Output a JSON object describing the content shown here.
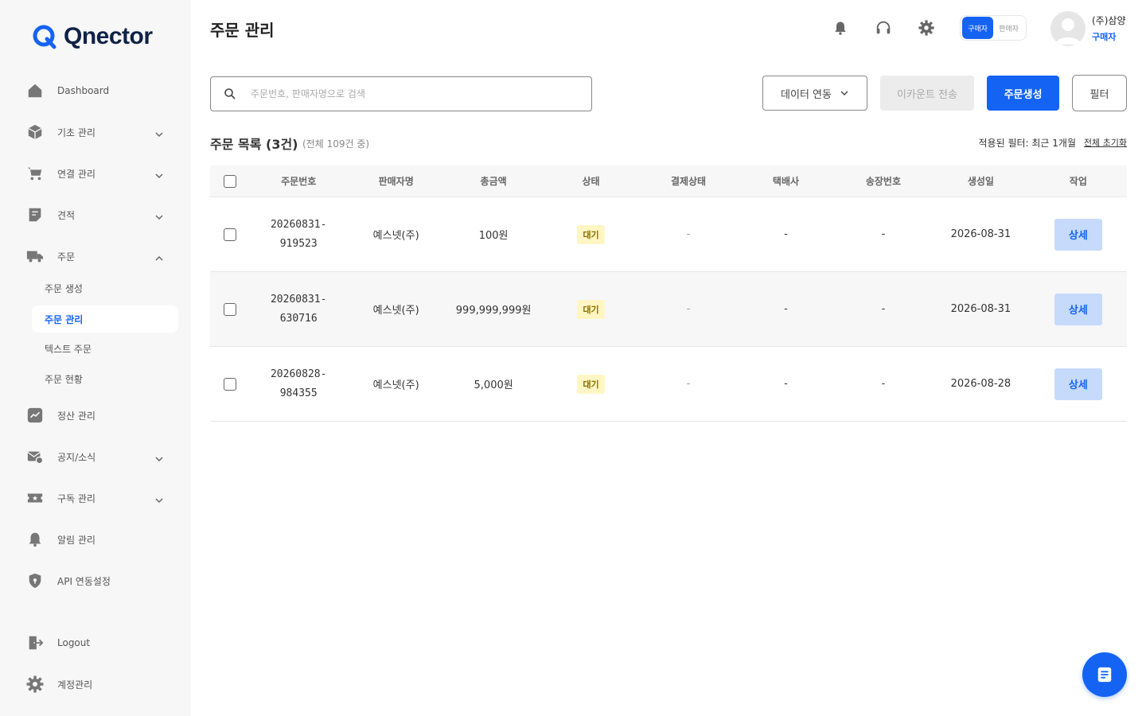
{
  "brand": {
    "name": "Qnector",
    "color": "#1463f3"
  },
  "sidebar": {
    "items": [
      {
        "label": "Dashboard",
        "icon": "home-icon"
      },
      {
        "label": "기초 관리",
        "icon": "box-icon"
      },
      {
        "label": "연결 관리",
        "icon": "cart-icon"
      },
      {
        "label": "견적",
        "icon": "receipt-icon"
      },
      {
        "label": "주문",
        "icon": "truck-icon"
      },
      {
        "label": "정산 관리",
        "icon": "trend-chart-icon"
      },
      {
        "label": "공지/소식",
        "icon": "mail-icon"
      },
      {
        "label": "구독 관리",
        "icon": "ticket-icon"
      },
      {
        "label": "알림 관리",
        "icon": "bell-icon"
      },
      {
        "label": "API 연동설정",
        "icon": "shield-icon"
      },
      {
        "label": "Logout",
        "icon": "logout-icon"
      },
      {
        "label": "계정관리",
        "icon": "gear-icon"
      }
    ],
    "order_sub": [
      {
        "label": "주문 생성"
      },
      {
        "label": "주문 관리"
      },
      {
        "label": "텍스트 주문"
      },
      {
        "label": "주문 현황"
      }
    ]
  },
  "header": {
    "title": "주문 관리",
    "role_buyer": "구매자",
    "role_seller": "판매자",
    "user_name": "(주)삼양",
    "user_role": "구매자"
  },
  "toolbar": {
    "search_placeholder": "주문번호, 판매자명으로 검색",
    "data_link": "데이터 연동",
    "ecount": "이카운트 전송",
    "create_order": "주문생성",
    "filter": "필터"
  },
  "list": {
    "title": "주문 목록 (3건)",
    "subtitle": "(전체 109건 중)",
    "applied_filter": "적용된 필터: 최근 1개월",
    "reset": "전체 초기화"
  },
  "table": {
    "headers": [
      "주문번호",
      "판매자명",
      "총금액",
      "상태",
      "결제상태",
      "택배사",
      "송장번호",
      "생성일",
      "작업"
    ],
    "rows": [
      {
        "order_no_1": "20260831-",
        "order_no_2": "919523",
        "seller": "예스넷(주)",
        "amount": "100원",
        "status": "대기",
        "payment": "-",
        "courier": "-",
        "tracking": "-",
        "created": "2026-08-31",
        "action": "상세"
      },
      {
        "order_no_1": "20260831-",
        "order_no_2": "630716",
        "seller": "예스넷(주)",
        "amount": "999,999,999원",
        "status": "대기",
        "payment": "-",
        "courier": "-",
        "tracking": "-",
        "created": "2026-08-31",
        "action": "상세"
      },
      {
        "order_no_1": "20260828-",
        "order_no_2": "984355",
        "seller": "예스넷(주)",
        "amount": "5,000원",
        "status": "대기",
        "payment": "-",
        "courier": "-",
        "tracking": "-",
        "created": "2026-08-28",
        "action": "상세"
      }
    ]
  }
}
